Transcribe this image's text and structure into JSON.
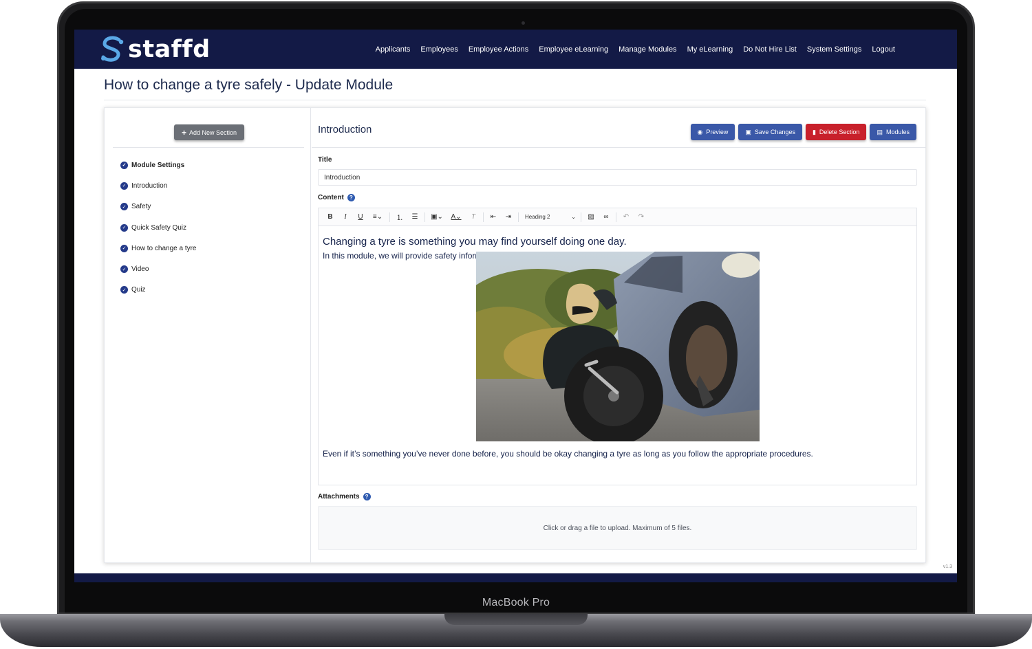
{
  "device": {
    "label": "MacBook Pro"
  },
  "app": {
    "brand": "staffd",
    "version": "v1.3"
  },
  "nav": {
    "items": [
      "Applicants",
      "Employees",
      "Employee Actions",
      "Employee eLearning",
      "Manage Modules",
      "My eLearning",
      "Do Not Hire List",
      "System Settings",
      "Logout"
    ]
  },
  "page": {
    "title": "How to change a tyre safely - Update Module"
  },
  "sidebar": {
    "add_button": "Add New Section",
    "items": [
      {
        "label": "Module Settings",
        "bold": true
      },
      {
        "label": "Introduction"
      },
      {
        "label": "Safety"
      },
      {
        "label": "Quick Safety Quiz"
      },
      {
        "label": "How to change a tyre"
      },
      {
        "label": "Video"
      },
      {
        "label": "Quiz"
      }
    ]
  },
  "section": {
    "heading": "Introduction",
    "buttons": {
      "preview": "Preview",
      "save": "Save Changes",
      "delete": "Delete Section",
      "modules": "Modules"
    }
  },
  "form": {
    "title_label": "Title",
    "title_value": "Introduction",
    "content_label": "Content",
    "toolbar": {
      "heading_select": "Heading 2"
    },
    "content": {
      "heading": "Changing a tyre is something you may find yourself doing one day.",
      "para1": "In this module, we will provide safety information and advice.",
      "para2": "Even if it’s something you’ve never done before, you should be okay changing a tyre as long as you follow the appropriate procedures."
    },
    "attachments_label": "Attachments",
    "dropzone_text": "Click or drag a file to upload. Maximum of 5 files."
  },
  "colors": {
    "navbar": "#131a46",
    "primary": "#3a58a8",
    "danger": "#c8202b",
    "check": "#243a8a"
  }
}
